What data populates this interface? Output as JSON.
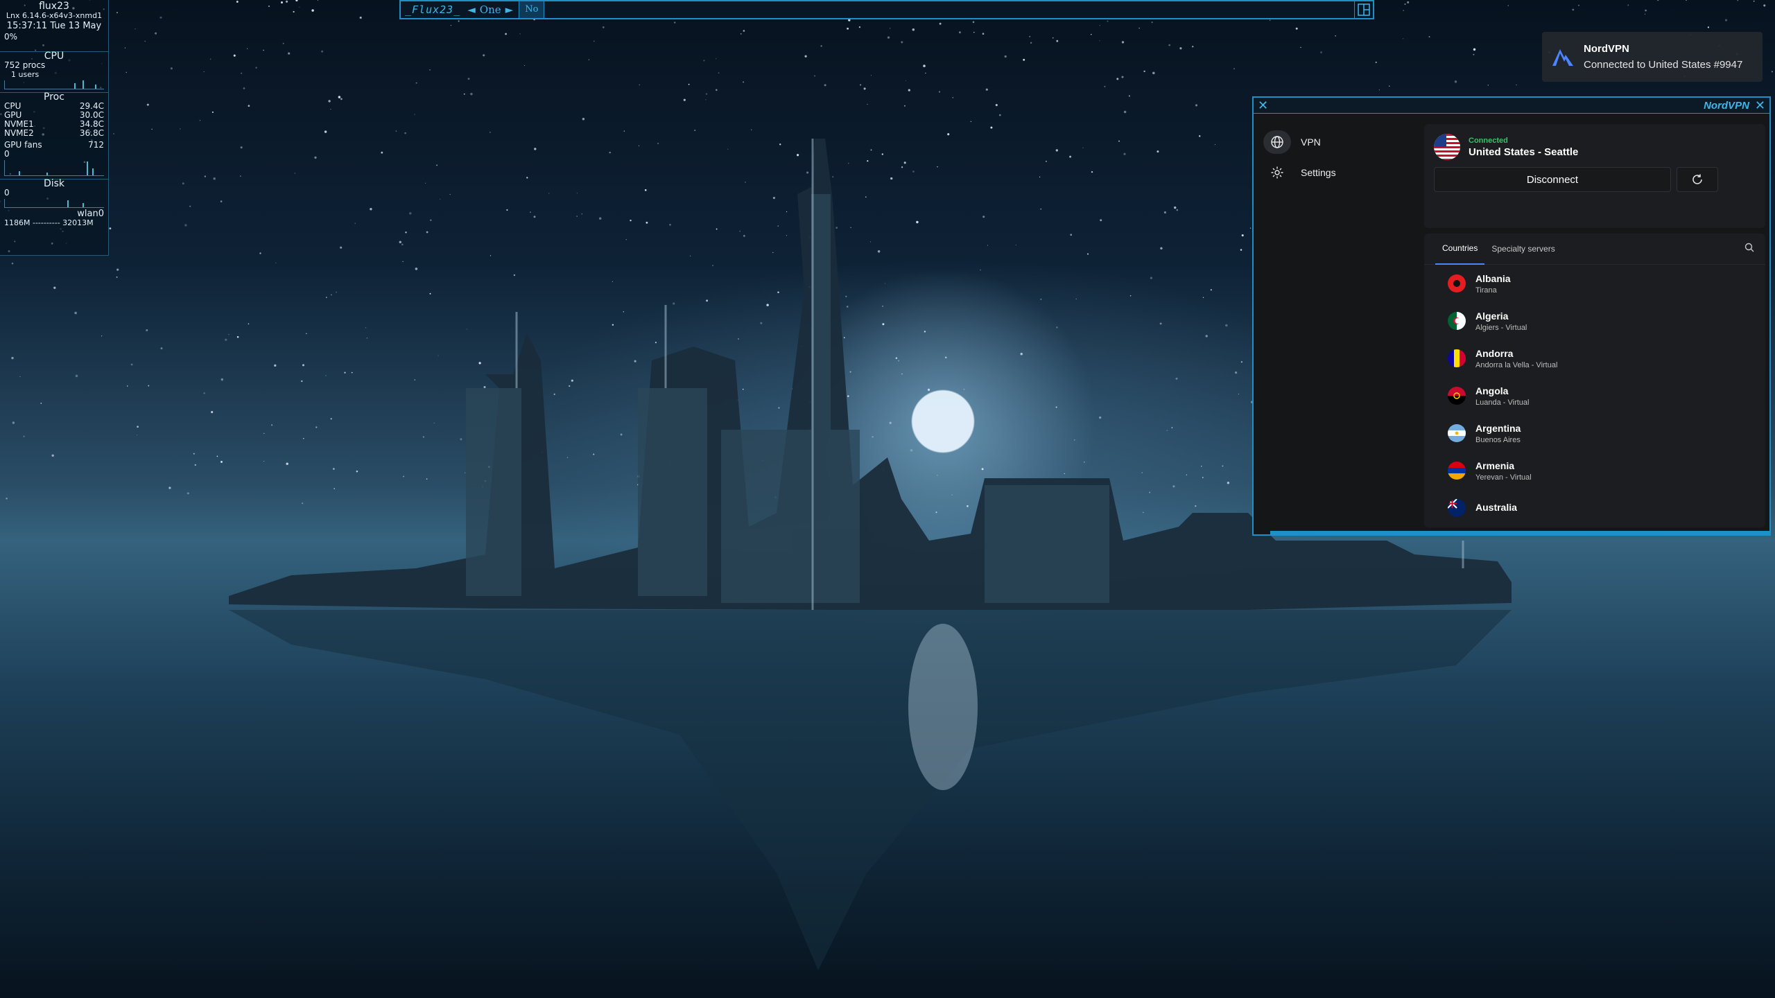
{
  "conky": {
    "hostname": "flux23",
    "kernel": "Lnx 6.14.6-x64v3-xnmd1",
    "clock": "15:37:11  Tue 13 May",
    "cpu_pct": "0%",
    "cpu_title": "CPU",
    "procs": "752 procs",
    "users": "1 users",
    "proc_title": "Proc",
    "temps": [
      {
        "label": "CPU",
        "value": "29.4C"
      },
      {
        "label": "GPU",
        "value": "30.0C"
      },
      {
        "label": "NVME1",
        "value": "34.8C"
      },
      {
        "label": "NVME2",
        "value": "36.8C"
      }
    ],
    "gpu_fans_label": "GPU fans",
    "gpu_fans_value": "712",
    "zero1": "0",
    "disk_title": "Disk",
    "zero2": "0",
    "net_iface": "wlan0",
    "net_line": "1186M ---------- 32013M"
  },
  "topbar": {
    "workspace_name": "_Flux23_",
    "prev_glyph": "◄",
    "workspace": "One",
    "next_glyph": "►",
    "task": "No"
  },
  "notification": {
    "icon": "nordvpn-logo-icon",
    "title": "NordVPN",
    "body": "Connected to United States #9947"
  },
  "window": {
    "title": "NordVPN",
    "close_glyph": "✕",
    "accent": "#1f8fc8",
    "nav": [
      {
        "label": "VPN",
        "icon": "globe-icon"
      },
      {
        "label": "Settings",
        "icon": "gear-icon"
      }
    ],
    "status": {
      "label": "Connected",
      "server": "United States - Seattle",
      "status_color": "#33c46a",
      "disconnect": "Disconnect"
    },
    "tabs": [
      "Countries",
      "Specialty servers"
    ],
    "countries": [
      {
        "name": "Albania",
        "city": "Tirana"
      },
      {
        "name": "Algeria",
        "city": "Algiers - Virtual"
      },
      {
        "name": "Andorra",
        "city": "Andorra la Vella - Virtual"
      },
      {
        "name": "Angola",
        "city": "Luanda - Virtual"
      },
      {
        "name": "Argentina",
        "city": "Buenos Aires"
      },
      {
        "name": "Armenia",
        "city": "Yerevan - Virtual"
      },
      {
        "name": "Australia",
        "city": ""
      }
    ]
  }
}
